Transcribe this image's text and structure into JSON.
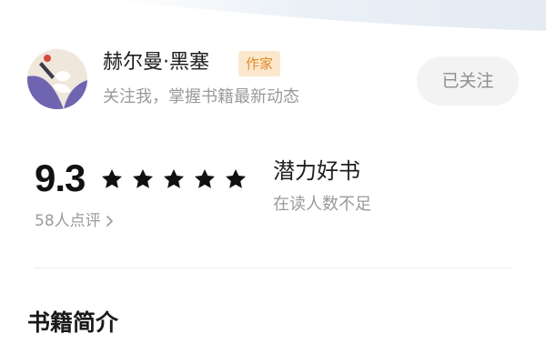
{
  "author": {
    "name": "赫尔曼·黑塞",
    "badge": "作家",
    "subtitle": "关注我，掌握书籍最新动态",
    "follow_button": "已关注",
    "avatar_icon": "author-avatar"
  },
  "rating": {
    "score": "9.3",
    "stars": 5,
    "review_count": "58人点评",
    "tag_title": "潜力好书",
    "tag_subtitle": "在读人数不足"
  },
  "section": {
    "title": "书籍简介"
  },
  "colors": {
    "badge_bg": "#fbe8cc",
    "badge_text": "#e08a2a",
    "muted_text": "#9a9a9a",
    "button_bg": "#f3f3f3"
  },
  "icons": {
    "star": "star-icon",
    "chevron": "chevron-right-icon"
  }
}
